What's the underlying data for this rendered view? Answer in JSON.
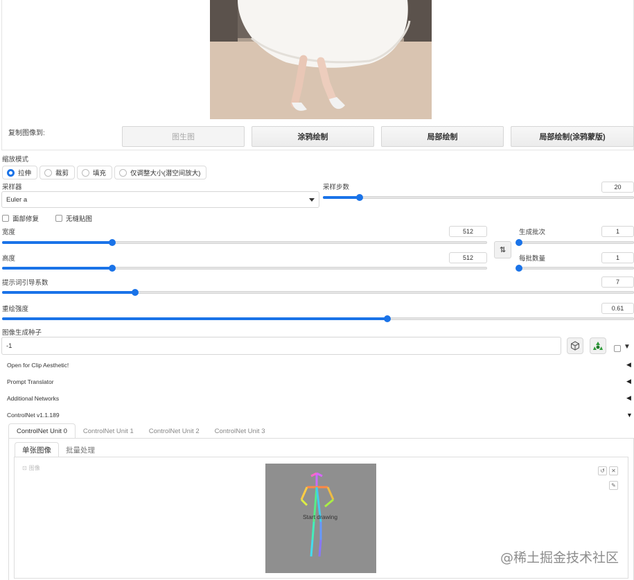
{
  "image_panel": {
    "copy_to_label": "复制图像到:",
    "copy_buttons": [
      "图生图",
      "涂鸦绘制",
      "局部绘制",
      "局部绘制(涂鸦蒙版)"
    ]
  },
  "resize_mode": {
    "label": "缩放模式",
    "options": [
      "拉伸",
      "裁剪",
      "填充",
      "仅调整大小(潜空间放大)"
    ],
    "selected": "拉伸"
  },
  "sampler": {
    "label": "采样器",
    "value": "Euler a"
  },
  "steps": {
    "label": "采样步数",
    "value": "20",
    "fraction": 0.118
  },
  "checkboxes": {
    "restore_faces": "面部修复",
    "tiling": "无缝贴图"
  },
  "width": {
    "label": "宽度",
    "value": "512",
    "fraction": 0.227
  },
  "height": {
    "label": "高度",
    "value": "512",
    "fraction": 0.227
  },
  "batch_count": {
    "label": "生成批次",
    "value": "1",
    "fraction": 0.0
  },
  "batch_size": {
    "label": "每批数量",
    "value": "1",
    "fraction": 0.0
  },
  "swap_label": "⇅",
  "cfg_scale": {
    "label": "提示词引导系数",
    "value": "7",
    "fraction": 0.21
  },
  "denoise": {
    "label": "重绘强度",
    "value": "0.61",
    "fraction": 0.61
  },
  "seed": {
    "label": "图像生成种子",
    "value": "-1"
  },
  "accordions": [
    {
      "label": "Open for Clip Aesthetic!",
      "arrow": "◀"
    },
    {
      "label": "Prompt Translator",
      "arrow": "◀"
    },
    {
      "label": "Additional Networks",
      "arrow": "◀"
    },
    {
      "label": "ControlNet v1.1.189",
      "arrow": "▼"
    }
  ],
  "controlnet_tabs": [
    "ControlNet Unit 0",
    "ControlNet Unit 1",
    "ControlNet Unit 2",
    "ControlNet Unit 3"
  ],
  "controlnet_subtabs": [
    "单张图像",
    "批量处理"
  ],
  "image_label": "图像",
  "canvas_text": "Start drawing",
  "watermark": "@稀土掘金技术社区",
  "colors": {
    "accent": "#1a73e8",
    "canvas_bg": "#8f8f8f"
  }
}
